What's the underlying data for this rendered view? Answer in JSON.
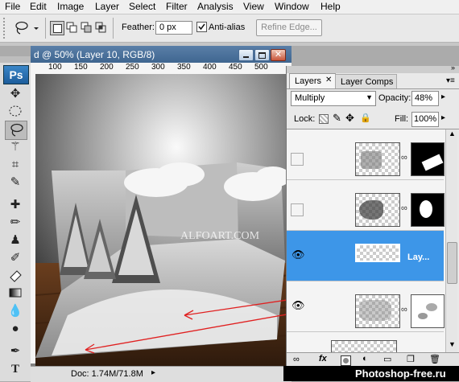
{
  "menu": [
    "File",
    "Edit",
    "Image",
    "Layer",
    "Select",
    "Filter",
    "Analysis",
    "View",
    "Window",
    "Help"
  ],
  "options": {
    "feather_label": "Feather:",
    "feather_value": "0 px",
    "antialias_label": "Anti-alias",
    "antialias_checked": true,
    "refine_edge_label": "Refine Edge..."
  },
  "tools": {
    "ps_logo": "Ps",
    "type_tool": "T"
  },
  "document": {
    "title": "d @ 50% (Layer 10, RGB/8)",
    "ruler_labels": [
      "100",
      "150",
      "200",
      "250",
      "300",
      "350",
      "400",
      "450",
      "500"
    ],
    "canvas_watermark": "ALFOART.COM",
    "status": "Doc: 1.74M/71.8M"
  },
  "layers_panel": {
    "tabs": [
      "Layers",
      "Layer Comps"
    ],
    "blend_mode": "Multiply",
    "opacity_label": "Opacity:",
    "opacity_value": "48%",
    "lock_label": "Lock:",
    "fill_label": "Fill:",
    "fill_value": "100%",
    "selected_layer_name": "Lay...",
    "selected_color": "#3d96e8"
  },
  "watermark": "Photoshop-free.ru",
  "colors": {
    "arrow": "#e02020",
    "selection_blue": "#3d96e8"
  }
}
